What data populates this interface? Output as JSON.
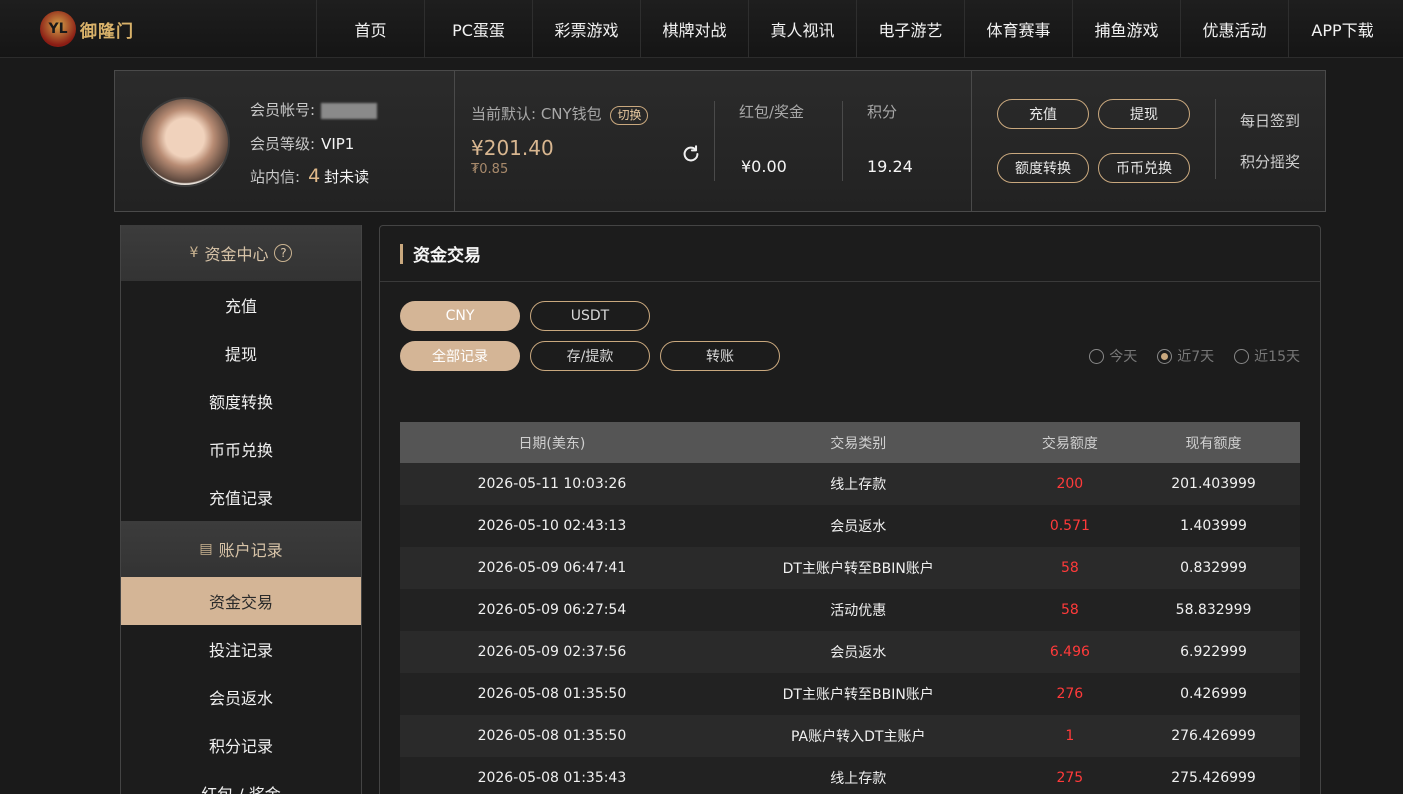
{
  "brand": {
    "logo_text": "御隆门"
  },
  "nav": [
    "首页",
    "PC蛋蛋",
    "彩票游戏",
    "棋牌对战",
    "真人视讯",
    "电子游艺",
    "体育赛事",
    "捕鱼游戏",
    "优惠活动",
    "APP下载"
  ],
  "account": {
    "username_label": "会员帐号:",
    "level_label": "会员等级:",
    "level_value": "VIP1",
    "inbox_label": "站内信:",
    "inbox_count": "4",
    "inbox_suffix": "封未读"
  },
  "wallet": {
    "label": "当前默认: CNY钱包",
    "switch_label": "切换",
    "balance": "¥201.40",
    "sub_balance": "₮0.85",
    "redpacket_label": "红包/奖金",
    "redpacket_value": "¥0.00",
    "points_label": "积分",
    "points_value": "19.24"
  },
  "actions": {
    "recharge": "充值",
    "withdraw": "提现",
    "transfer": "额度转换",
    "exchange": "币币兑换",
    "daily_signin": "每日签到",
    "points_lottery": "积分摇奖"
  },
  "sidemenu": {
    "funds_head": "资金中心",
    "funds_items": [
      "充值",
      "提现",
      "额度转换",
      "币币兑换",
      "充值记录"
    ],
    "records_head": "账户记录",
    "records_items": [
      "资金交易",
      "投注记录",
      "会员返水",
      "积分记录",
      "红包 / 奖金"
    ],
    "active": "资金交易"
  },
  "main": {
    "title": "资金交易",
    "currency_tabs": [
      "CNY",
      "USDT"
    ],
    "type_tabs": [
      "全部记录",
      "存/提款",
      "转账"
    ],
    "ranges": [
      "今天",
      "近7天",
      "近15天"
    ],
    "selected_range": "近7天",
    "columns": [
      "日期(美东)",
      "交易类别",
      "交易额度",
      "现有额度"
    ],
    "rows": [
      [
        "2026-05-11 10:03:26",
        "线上存款",
        "200",
        "201.403999"
      ],
      [
        "2026-05-10 02:43:13",
        "会员返水",
        "0.571",
        "1.403999"
      ],
      [
        "2026-05-09 06:47:41",
        "DT主账户转至BBIN账户",
        "58",
        "0.832999"
      ],
      [
        "2026-05-09 06:27:54",
        "活动优惠",
        "58",
        "58.832999"
      ],
      [
        "2026-05-09 02:37:56",
        "会员返水",
        "6.496",
        "6.922999"
      ],
      [
        "2026-05-08 01:35:50",
        "DT主账户转至BBIN账户",
        "276",
        "0.426999"
      ],
      [
        "2026-05-08 01:35:50",
        "PA账户转入DT主账户",
        "1",
        "276.426999"
      ],
      [
        "2026-05-08 01:35:43",
        "线上存款",
        "275",
        "275.426999"
      ]
    ]
  },
  "colors": {
    "accent": "#d4b596",
    "amount": "#ff3a3a",
    "background": "#1a1a1a"
  }
}
